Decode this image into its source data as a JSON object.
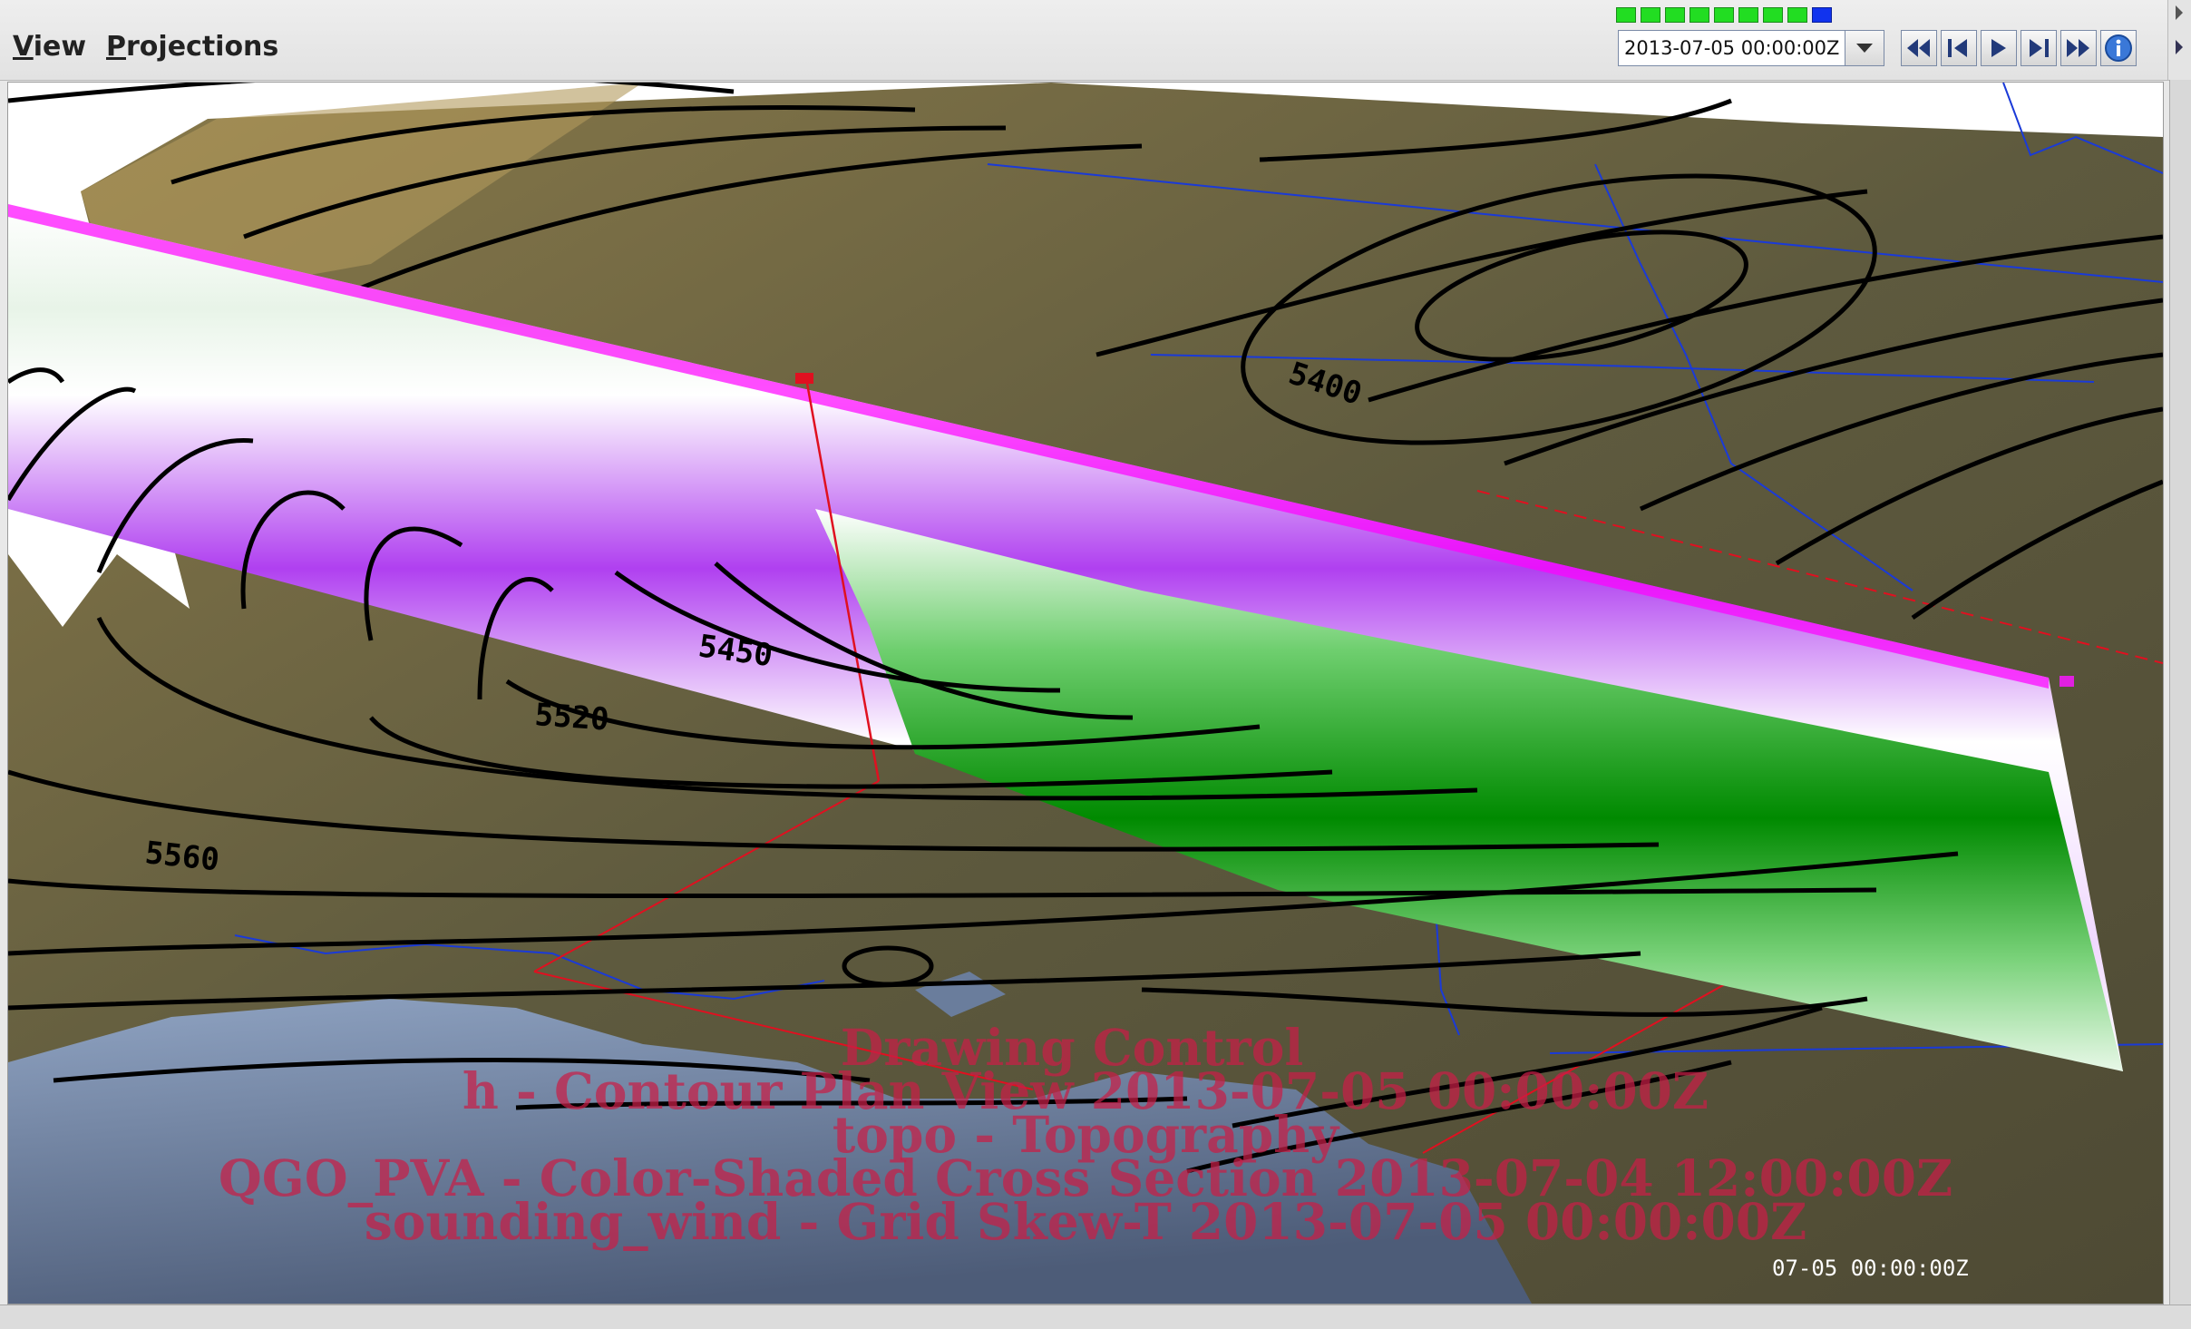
{
  "menu": {
    "view": "View",
    "projections": "Projections"
  },
  "animation": {
    "current_time": "2013-07-05 00:00:00Z",
    "frames_total": 9,
    "active_frame_index": 9,
    "frame_color_done": "#22dd22",
    "frame_color_active": "#1133ee",
    "buttons": [
      "first-frame",
      "step-back",
      "play",
      "step-forward",
      "last-frame",
      "info"
    ]
  },
  "display": {
    "legend_title": "Drawing Control",
    "legend_lines": [
      "h - Contour Plan View 2013-07-05 00:00:00Z",
      "topo - Topography",
      "QGO_PVA - Color-Shaded Cross Section 2013-07-04 12:00:00Z",
      "sounding_wind - Grid Skew-T 2013-07-05 00:00:00Z"
    ],
    "time_overlay": "07-05 00:00:00Z",
    "contour_labels": [
      "5400",
      "5450",
      "5520",
      "5560"
    ],
    "colors": {
      "legend_text": "#c81e46",
      "contours": "#000000",
      "cross_section_positive": "#008a00",
      "cross_section_negative": "#9a10e0",
      "terrain": "#6b6446",
      "ocean": "#5a6b85",
      "boundaries": "#1a3ad8",
      "selection": "#e01020"
    }
  }
}
